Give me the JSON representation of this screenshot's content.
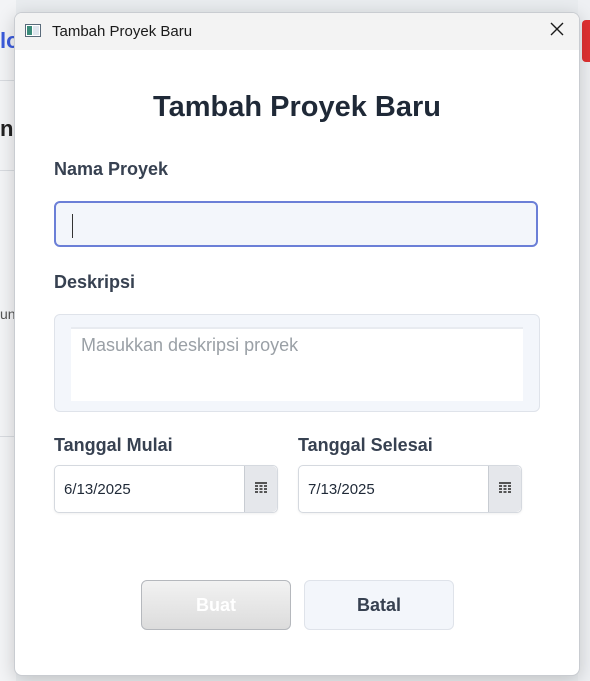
{
  "background": {
    "left_texts": [
      "lo",
      "nc",
      "un"
    ]
  },
  "dialog": {
    "window_title": "Tambah Proyek Baru",
    "heading": "Tambah Proyek Baru",
    "name_field": {
      "label": "Nama Proyek",
      "value": "",
      "placeholder": ""
    },
    "description_field": {
      "label": "Deskripsi",
      "value": "",
      "placeholder": "Masukkan deskripsi proyek"
    },
    "start_date": {
      "label": "Tanggal Mulai",
      "value": "6/13/2025"
    },
    "end_date": {
      "label": "Tanggal Selesai",
      "value": "7/13/2025"
    },
    "buttons": {
      "create": "Buat",
      "cancel": "Batal"
    }
  },
  "icons": {
    "close": "close-icon",
    "calendar": "calendar-icon",
    "app": "window-app-icon"
  },
  "colors": {
    "focus_border": "#6b7fd7",
    "heading": "#1f2937",
    "label": "#374151",
    "accent_bg_text": "#3b5bdb",
    "danger": "#e03131"
  }
}
